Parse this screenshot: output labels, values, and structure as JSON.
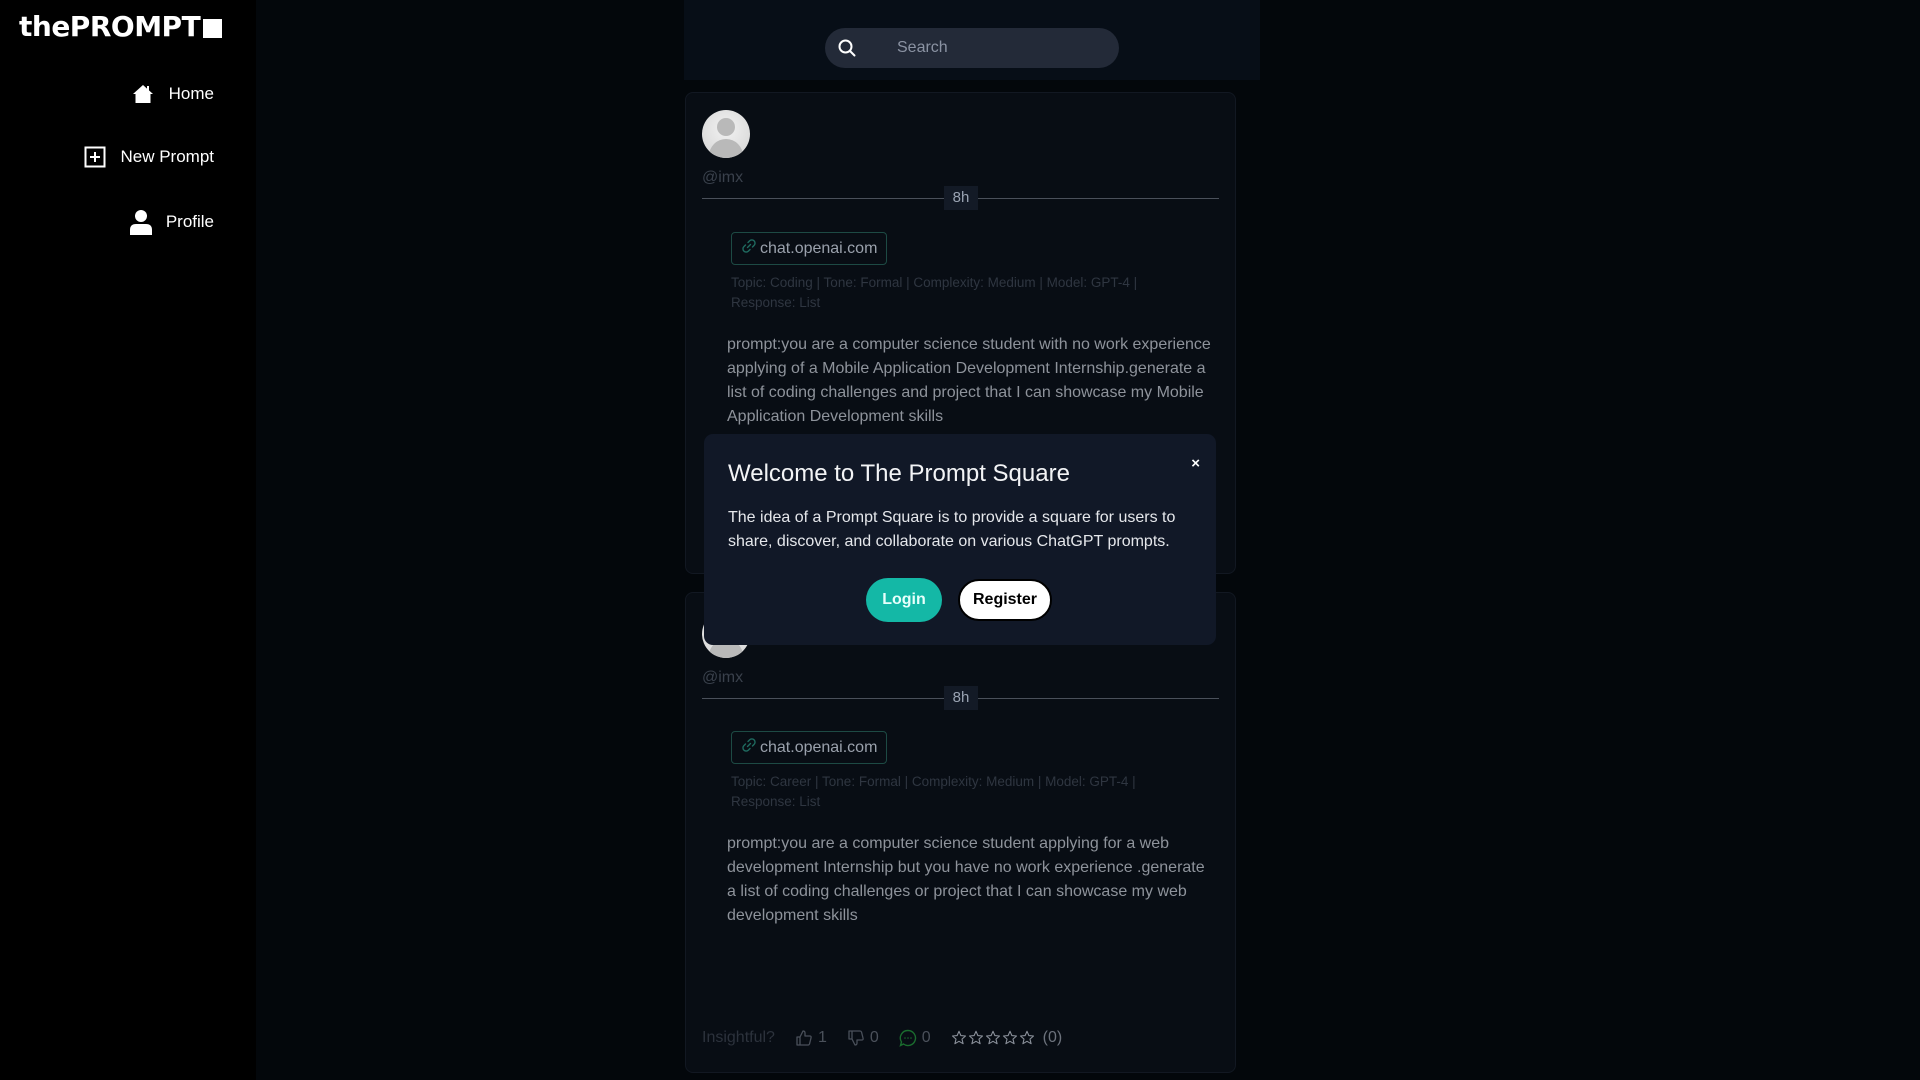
{
  "brand": {
    "name": "thePROMPT"
  },
  "sidebar": {
    "items": [
      {
        "label": "Home",
        "icon": "home-icon"
      },
      {
        "label": "New Prompt",
        "icon": "plus-square-icon"
      },
      {
        "label": "Profile",
        "icon": "user-icon"
      }
    ]
  },
  "search": {
    "placeholder": "Search",
    "value": ""
  },
  "colors": {
    "accent": "#14b8a6",
    "background": "#03070b",
    "sidebar": "#000000",
    "modal": "#111827"
  },
  "posts": [
    {
      "handle": "@imx",
      "time": "8h",
      "link": "chat.openai.com",
      "meta": "Topic: Coding | Tone: Formal | Complexity: Medium | Model: GPT-4 | Response: List",
      "prompt": "prompt:you are a computer science student with no work experience applying of a Mobile Application Development Internship.generate a list of coding challenges and project that I can showcase my Mobile Application Development skills"
    },
    {
      "handle": "@imx",
      "time": "8h",
      "link": "chat.openai.com",
      "meta": "Topic: Career | Tone: Formal | Complexity: Medium | Model: GPT-4 | Response: List",
      "prompt": "prompt:you are a computer science student applying for a web development Internship but you have no work experience .generate a list of coding challenges or project that I can showcase my web development skills",
      "actions": {
        "insightful_label": "Insightful?",
        "likes": "1",
        "dislikes": "0",
        "comments": "0",
        "stars_filled": 0,
        "stars_total": 5,
        "rating_count": "(0)"
      }
    }
  ],
  "modal": {
    "title": "Welcome to The Prompt Square",
    "text": "The idea of a Prompt Square is to provide a square for users to share, discover, and collaborate on various ChatGPT prompts.",
    "close_label": "×",
    "login_label": "Login",
    "register_label": "Register"
  }
}
